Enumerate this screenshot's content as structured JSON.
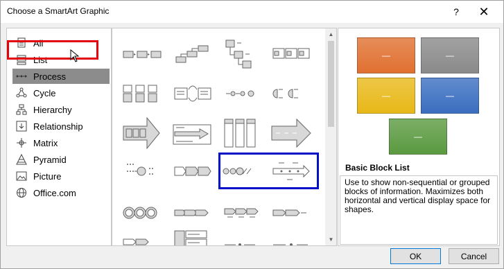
{
  "window": {
    "title": "Choose a SmartArt Graphic",
    "help_label": "?",
    "close_label": "✕"
  },
  "categories": [
    {
      "label": "All",
      "icon": "all-icon"
    },
    {
      "label": "List",
      "icon": "list-icon"
    },
    {
      "label": "Process",
      "icon": "process-icon",
      "selected": true
    },
    {
      "label": "Cycle",
      "icon": "cycle-icon"
    },
    {
      "label": "Hierarchy",
      "icon": "hierarchy-icon"
    },
    {
      "label": "Relationship",
      "icon": "relationship-icon"
    },
    {
      "label": "Matrix",
      "icon": "matrix-icon"
    },
    {
      "label": "Pyramid",
      "icon": "pyramid-icon"
    },
    {
      "label": "Picture",
      "icon": "picture-icon"
    },
    {
      "label": "Office.com",
      "icon": "globe-icon"
    }
  ],
  "preview": {
    "swatch_label": "—",
    "swatch_colors": [
      "#e07030",
      "#8a8a8a",
      "#e8b818",
      "#3a6ec0",
      "#5a9a40"
    ],
    "title": "Basic Block List",
    "description": "Use to show non-sequential or grouped blocks of information. Maximizes both horizontal and vertical display space for shapes."
  },
  "buttons": {
    "ok": "OK",
    "cancel": "Cancel"
  },
  "colors": {
    "selected_outline": "#e3000b",
    "highlight_outline": "#0010c8"
  }
}
